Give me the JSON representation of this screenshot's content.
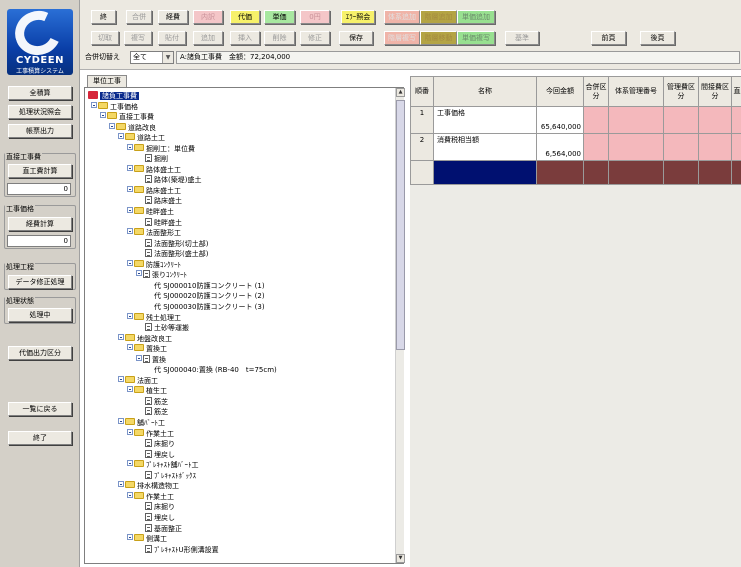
{
  "logo": {
    "name": "CYDEEN",
    "subtitle": "工事積算システム"
  },
  "sidebar": {
    "btn_all": "全積算",
    "btn_status": "処理状況照会",
    "btn_report": "帳票出力",
    "grp_direct": "直接工事費",
    "btn_direct_calc": "直工費計算",
    "direct_value": "0",
    "grp_contract": "工事価格",
    "btn_expense_calc": "経費計算",
    "contract_value": "0",
    "grp_process": "処理工程",
    "btn_data_fix": "データ修正処理",
    "grp_state": "処理状態",
    "btn_processing": "処理中",
    "btn_code_output": "代価出力区分",
    "btn_back": "一覧に戻る",
    "btn_end": "終了"
  },
  "toolbar": {
    "row1": [
      "終",
      "合併",
      "経費",
      "内訳",
      "代価",
      "単価",
      "0円",
      "ｴﾗｰ照会",
      "体系追加",
      "階層追加",
      "単価追加"
    ],
    "row2": [
      "切取",
      "複写",
      "貼付",
      "追加",
      "挿入",
      "削除",
      "修正",
      "保存",
      "階層複写",
      "階層移動",
      "単価複写",
      "基準",
      "前頁",
      "後頁"
    ],
    "merge_label": "合併切替え",
    "merge_value": "全て",
    "info_text": "A:諸負工事費　金額：72,204,000"
  },
  "tree": {
    "tab_label": "単位工事",
    "root": "諸負工事費",
    "nodes": [
      "工事価格",
      "直接工事費",
      "道路改良",
      "道路土工",
      "掘削工：単位費",
      "掘削",
      "路体盛土工",
      "路体(築堤)盛土",
      "路床盛土工",
      "路床盛土",
      "畦畔盛土",
      "畦畔盛土",
      "法面整形工",
      "法面整形(切土部)",
      "法面整形(盛土部)",
      "防護ｺﾝｸﾘｰﾄ",
      "張りｺﾝｸﾘｰﾄ",
      "代 SJ000010防護コンクリート (1)",
      "代 SJ000020防護コンクリート (2)",
      "代 SJ000030防護コンクリート (3)",
      "残土処理工",
      "土砂等運搬",
      "地盤改良工",
      "置換工",
      "置換",
      "代 SJ000040:置換 (RB-40　t=75cm)",
      "法面工",
      "植生工",
      "筋芝",
      "筋芝",
      "舗ﾊﾞｰﾄ工",
      "作業土工",
      "床掘り",
      "埋戻し",
      "ﾌﾟﾚｷｬｽﾄ舗ﾊﾞｰﾄ工",
      "ﾌﾟﾚｷｬｽﾄﾎﾞｯｸｽ",
      "排水構造物工",
      "作業土工",
      "床掘り",
      "埋戻し",
      "基面整正",
      "側溝工",
      "ﾌﾟﾚｷｬｽﾄU形側溝設置"
    ]
  },
  "grid": {
    "headers": [
      "順番",
      "名称",
      "今回金額",
      "合併区分",
      "体系管理番号",
      "管理費区分",
      "間接費区分",
      "直"
    ],
    "rows": [
      {
        "num": "1",
        "name": "工事価格",
        "amount": "65,640,000"
      },
      {
        "num": "2",
        "name": "消費税相当額",
        "amount": "6,564,000"
      }
    ]
  }
}
